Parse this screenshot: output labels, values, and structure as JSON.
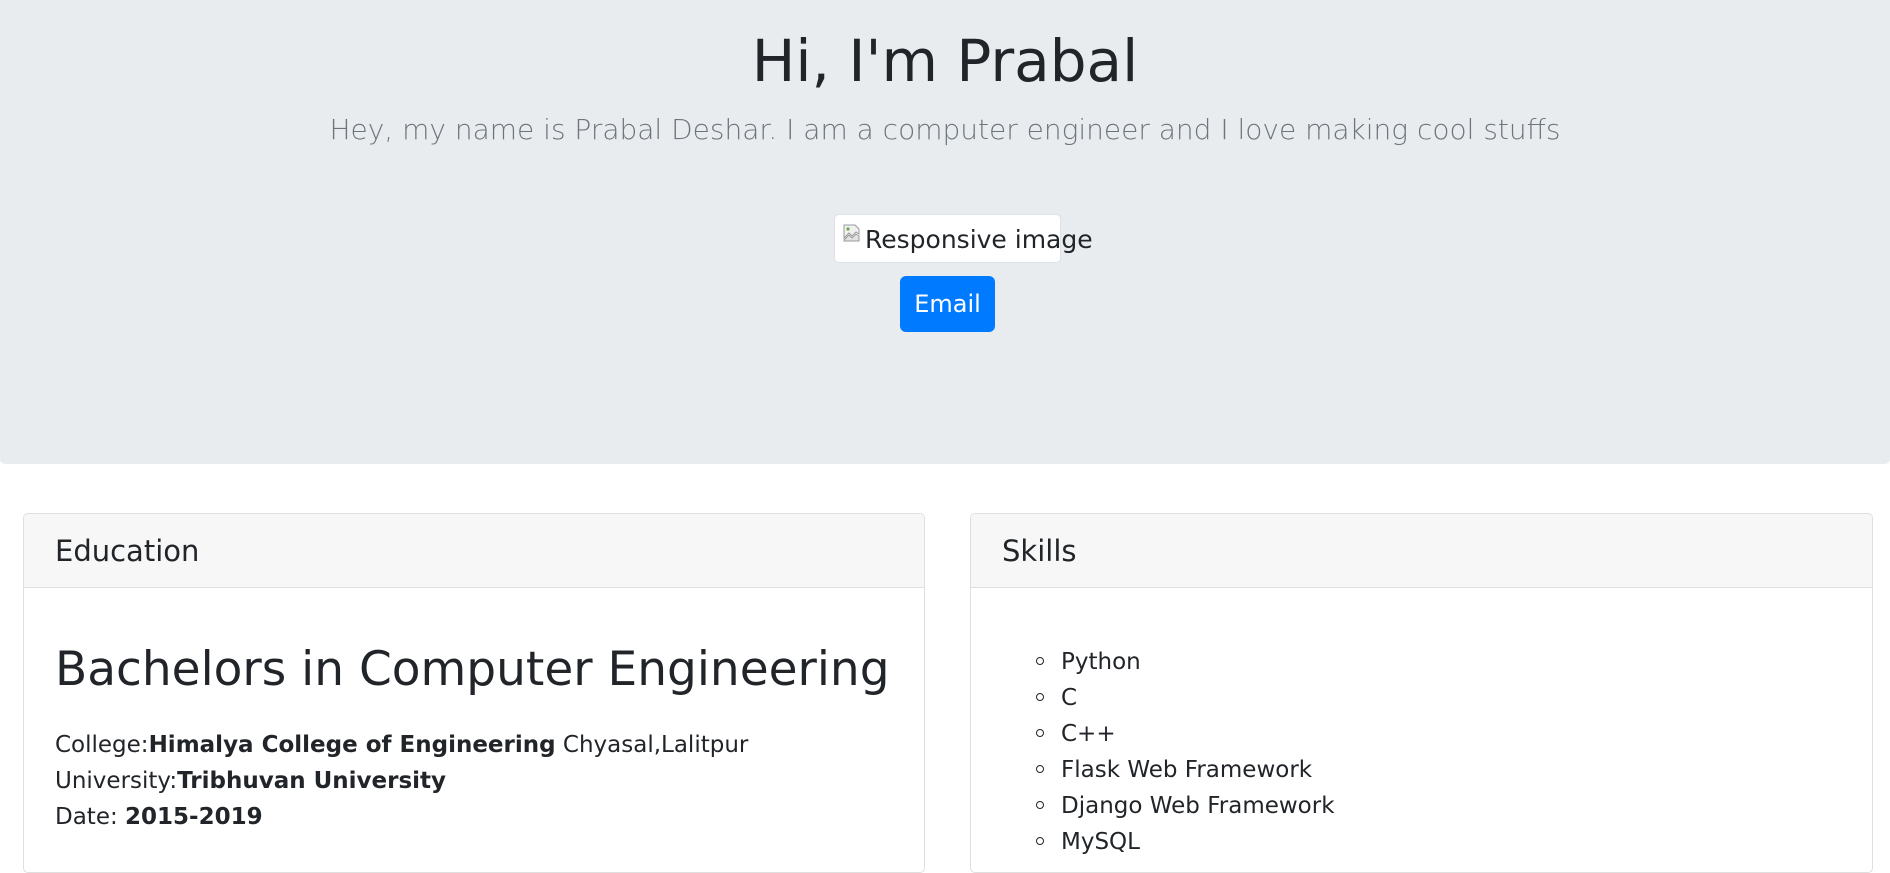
{
  "hero": {
    "title": "Hi, I'm Prabal",
    "lead": "Hey, my name is Prabal Deshar. I am a computer engineer and I love making cool stuffs",
    "image_alt": "Responsive image",
    "email_button": "Email",
    "colors": {
      "background": "#e9ecef",
      "button": "#007bff",
      "lead_text": "#6c757d"
    }
  },
  "education": {
    "header": "Education",
    "degree": "Bachelors in Computer Engineering",
    "college_label": "College:",
    "college_name": "Himalya College of Engineering",
    "college_location": " Chyasal,Lalitpur",
    "university_label": "University:",
    "university_name": "Tribhuvan University",
    "date_label": "Date: ",
    "date_value": "2015-2019"
  },
  "skills": {
    "header": "Skills",
    "items": [
      "Python",
      "C",
      "C++",
      "Flask Web Framework",
      "Django Web Framework",
      "MySQL"
    ]
  }
}
